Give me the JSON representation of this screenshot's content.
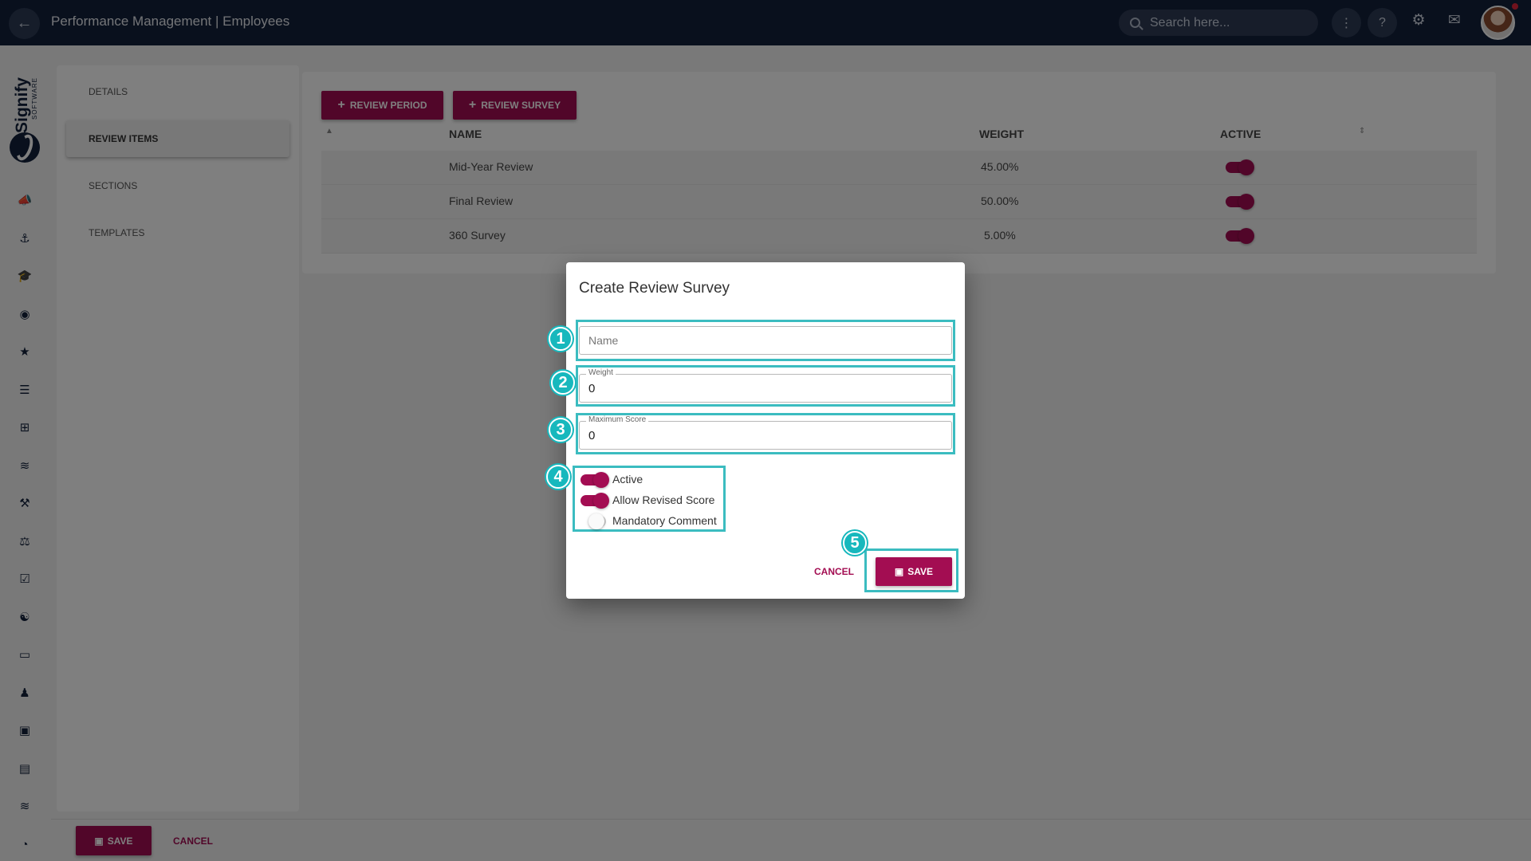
{
  "header": {
    "back_icon": "arrow-left-icon",
    "title": "Performance Management | Employees",
    "search_placeholder": "Search here..."
  },
  "brand": {
    "name": "Signify",
    "sub": "SOFTWARE"
  },
  "sidebar": {
    "items": [
      {
        "label": "DETAILS"
      },
      {
        "label": "REVIEW ITEMS"
      },
      {
        "label": "SECTIONS"
      },
      {
        "label": "TEMPLATES"
      }
    ]
  },
  "toolbar": {
    "review_period_label": "REVIEW PERIOD",
    "review_survey_label": "REVIEW SURVEY"
  },
  "table": {
    "columns": [
      "NAME",
      "WEIGHT",
      "ACTIVE"
    ],
    "rows": [
      {
        "name": "Mid-Year Review",
        "weight": "45.00%",
        "active": true
      },
      {
        "name": "Final Review",
        "weight": "50.00%",
        "active": true
      },
      {
        "name": "360 Survey",
        "weight": "5.00%",
        "active": true
      }
    ]
  },
  "footer": {
    "save_label": "SAVE",
    "cancel_label": "CANCEL"
  },
  "dialog": {
    "title": "Create Review Survey",
    "name_placeholder": "Name",
    "weight_label": "Weight",
    "weight_value": "0",
    "max_score_label": "Maximum Score",
    "max_score_value": "0",
    "switches": [
      {
        "label": "Active",
        "on": true
      },
      {
        "label": "Allow Revised Score",
        "on": true
      },
      {
        "label": "Mandatory Comment",
        "on": false
      }
    ],
    "cancel_label": "CANCEL",
    "save_label": "SAVE"
  },
  "annotations": [
    "1",
    "2",
    "3",
    "4",
    "5"
  ],
  "colors": {
    "topbar": "#12213b",
    "accent": "#a30d52",
    "highlight": "#17b8bd"
  }
}
